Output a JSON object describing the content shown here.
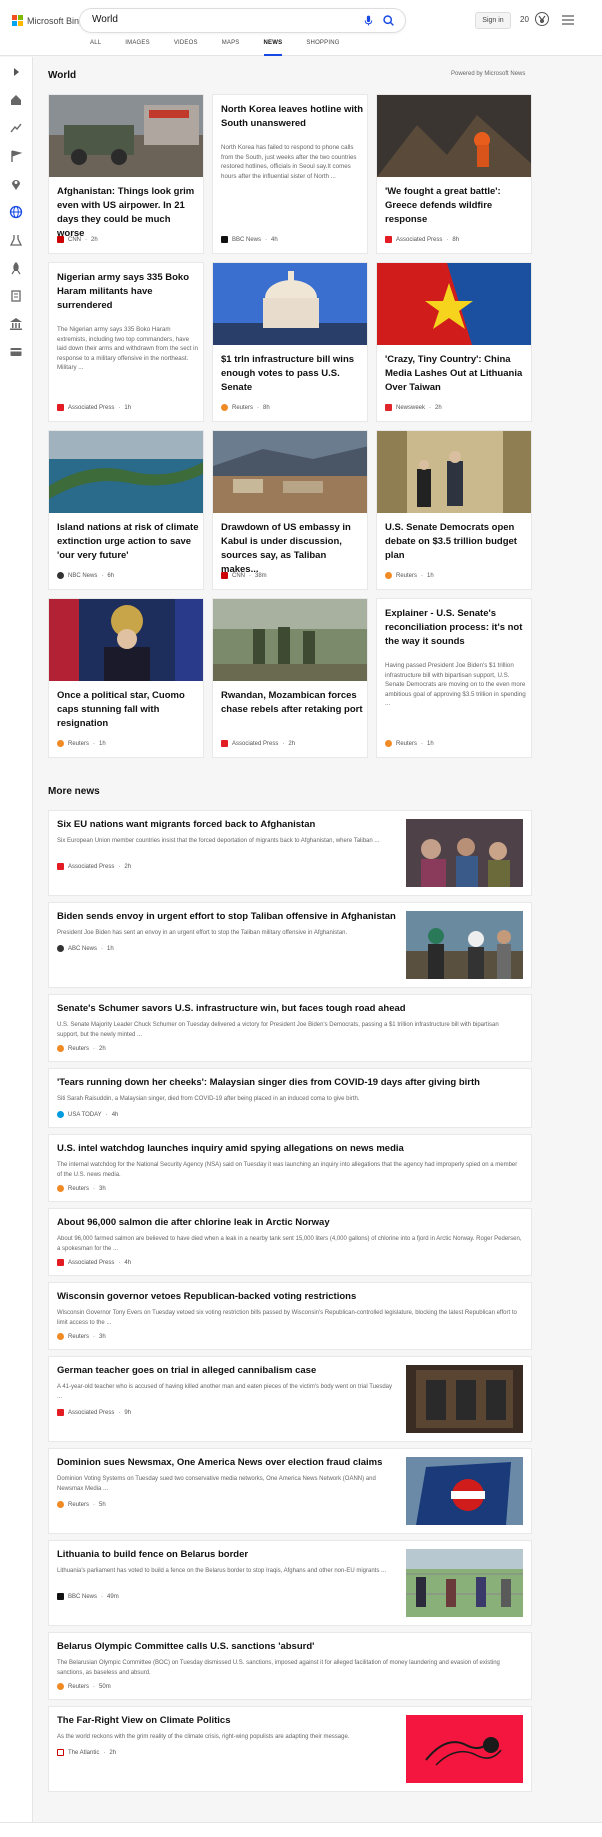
{
  "brand": {
    "name": "Microsoft Bing"
  },
  "search": {
    "query": "World"
  },
  "header": {
    "sign_in": "Sign in",
    "rewards_count": "20"
  },
  "tabs": [
    {
      "label": "ALL"
    },
    {
      "label": "IMAGES"
    },
    {
      "label": "VIDEOS"
    },
    {
      "label": "MAPS"
    },
    {
      "label": "NEWS"
    },
    {
      "label": "SHOPPING"
    }
  ],
  "section": {
    "title": "World",
    "powered_by": "Powered by Microsoft News",
    "more_news": "More news"
  },
  "cards": [
    {
      "title": "Afghanistan: Things look grim even with US airpower. In 21 days they could be much worse",
      "desc": "",
      "source": "CNN",
      "time": "2h"
    },
    {
      "title": "North Korea leaves hotline with South unanswered",
      "desc": "North Korea has failed to respond to phone calls from the South, just weeks after the two countries restored hotlines, officials in Seoul say.It comes hours after the influential sister of North ...",
      "source": "BBC News",
      "time": "4h"
    },
    {
      "title": "'We fought a great battle': Greece defends wildfire response",
      "desc": "",
      "source": "Associated Press",
      "time": "8h"
    },
    {
      "title": "Nigerian army says 335 Boko Haram militants have surrendered",
      "desc": "The Nigerian army says 335 Boko Haram extremists, including two top commanders, have laid down their arms and withdrawn from the sect in response to a military offensive in the northeast. Military ...",
      "source": "Associated Press",
      "time": "1h"
    },
    {
      "title": "$1 trln infrastructure bill wins enough votes to pass U.S. Senate",
      "desc": "",
      "source": "Reuters",
      "time": "8h"
    },
    {
      "title": "'Crazy, Tiny Country': China Media Lashes Out at Lithuania Over Taiwan",
      "desc": "",
      "source": "Newsweek",
      "time": "2h"
    },
    {
      "title": "Island nations at risk of climate extinction urge action to save 'our very future'",
      "desc": "",
      "source": "NBC News",
      "time": "6h"
    },
    {
      "title": "Drawdown of US embassy in Kabul is under discussion, sources say, as Taliban makes...",
      "desc": "",
      "source": "CNN",
      "time": "38m"
    },
    {
      "title": "U.S. Senate Democrats open debate on $3.5 trillion budget plan",
      "desc": "",
      "source": "Reuters",
      "time": "1h"
    },
    {
      "title": "Once a political star, Cuomo caps stunning fall with resignation",
      "desc": "",
      "source": "Reuters",
      "time": "1h"
    },
    {
      "title": "Rwandan, Mozambican forces chase rebels after retaking port",
      "desc": "",
      "source": "Associated Press",
      "time": "2h"
    },
    {
      "title": "Explainer - U.S. Senate's reconciliation process: it's not the way it sounds",
      "desc": "Having passed President Joe Biden's $1 trillion infrastructure bill with bipartisan support, U.S. Senate Democrats are moving on to the even more ambitious goal of approving $3.5 trillion in spending ...",
      "source": "Reuters",
      "time": "1h"
    }
  ],
  "news": [
    {
      "title": "Six EU nations want migrants forced back to Afghanistan",
      "desc": "Six European Union member countries insist that the forced deportation of migrants back to Afghanistan, where Taliban ...",
      "source": "Associated Press",
      "time": "2h"
    },
    {
      "title": "Biden sends envoy in urgent effort to stop Taliban offensive in Afghanistan",
      "desc": "President Joe Biden has sent an envoy in an urgent effort to stop the Taliban military offensive in Afghanistan.",
      "source": "ABC News",
      "time": "1h"
    },
    {
      "title": "Senate's Schumer savors U.S. infrastructure win, but faces tough road ahead",
      "desc": "U.S. Senate Majority Leader Chuck Schumer on Tuesday delivered a victory for President Joe Biden's Democrats, passing a $1 trillion infrastructure bill with bipartisan support, but the newly minted ...",
      "source": "Reuters",
      "time": "2h"
    },
    {
      "title": "'Tears running down her cheeks': Malaysian singer dies from COVID-19 days after giving birth",
      "desc": "Siti Sarah Raisuddin, a Malaysian singer, died from COVID-19 after being placed in an induced coma to give birth.",
      "source": "USA TODAY",
      "time": "4h"
    },
    {
      "title": "U.S. intel watchdog launches inquiry amid spying allegations on news media",
      "desc": "The internal watchdog for the National Security Agency (NSA) said on Tuesday it was launching an inquiry into allegations that the agency had improperly spied on a member of the U.S. news media.",
      "source": "Reuters",
      "time": "3h"
    },
    {
      "title": "About 96,000 salmon die after chlorine leak in Arctic Norway",
      "desc": "About 96,000 farmed salmon are believed to have died when a leak in a nearby tank sent 15,000 liters (4,000 gallons) of chlorine into a fjord in Arctic Norway. Roger Pedersen, a spokesman for the ...",
      "source": "Associated Press",
      "time": "4h"
    },
    {
      "title": "Wisconsin governor vetoes Republican-backed voting restrictions",
      "desc": "Wisconsin Governor Tony Evers on Tuesday vetoed six voting restriction bills passed by Wisconsin's Republican-controlled legislature, blocking the latest Republican effort to limit access to the ...",
      "source": "Reuters",
      "time": "3h"
    },
    {
      "title": "German teacher goes on trial in alleged cannibalism case",
      "desc": "A 41-year-old teacher who is accused of having killed another man and eaten pieces of the victim's body went on trial Tuesday ...",
      "source": "Associated Press",
      "time": "9h"
    },
    {
      "title": "Dominion sues Newsmax, One America News over election fraud claims",
      "desc": "Dominion Voting Systems on Tuesday sued two conservative media networks, One America News Network (OANN) and Newsmax Media ...",
      "source": "Reuters",
      "time": "5h"
    },
    {
      "title": "Lithuania to build fence on Belarus border",
      "desc": "Lithuania's parliament has voted to build a fence on the Belarus border to stop Iraqis, Afghans and other non-EU migrants ...",
      "source": "BBC News",
      "time": "49m"
    },
    {
      "title": "Belarus Olympic Committee calls U.S. sanctions 'absurd'",
      "desc": "The Belarusian Olympic Committee (BOC) on Tuesday dismissed U.S. sanctions, imposed against it for alleged facilitation of money laundering and evasion of existing sanctions, as baseless and absurd.",
      "source": "Reuters",
      "time": "50m"
    },
    {
      "title": "The Far-Right View on Climate Politics",
      "desc": "As the world reckons with the grim reality of the climate crisis, right-wing populists are adapting their message.",
      "source": "The Atlantic",
      "time": "2h"
    }
  ],
  "colors": {
    "accent": "#174ae4",
    "card_border": "#e8e8e8"
  }
}
